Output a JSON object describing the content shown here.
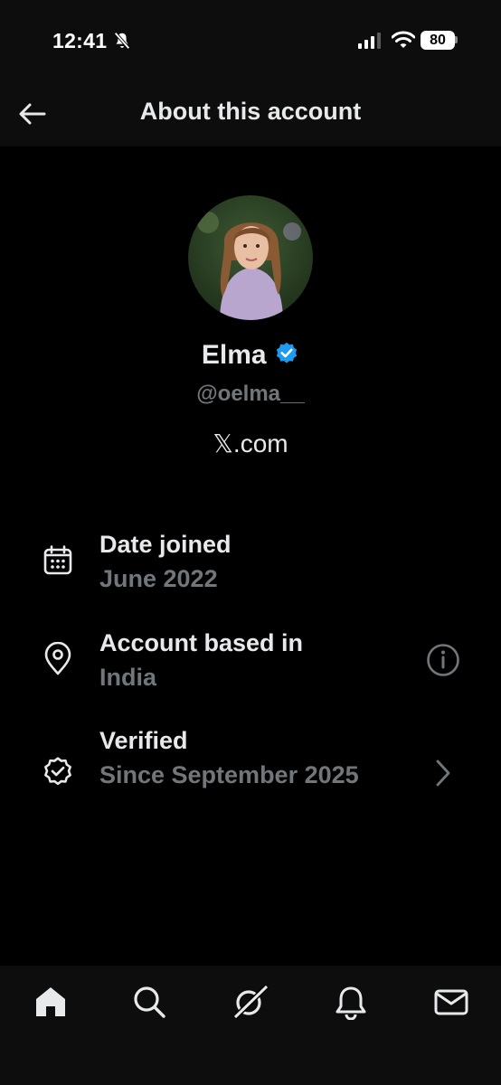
{
  "status_bar": {
    "time": "12:41",
    "battery": "80"
  },
  "header": {
    "title": "About this account"
  },
  "profile": {
    "name": "Elma",
    "handle": "@oelma__",
    "site": "𝕏.com"
  },
  "rows": [
    {
      "title": "Date joined",
      "value": "June 2022",
      "icon": "calendar-icon"
    },
    {
      "title": "Account based in",
      "value": "India",
      "icon": "location-pin-icon",
      "action_icon": "info-icon"
    },
    {
      "title": "Verified",
      "value": "Since September 2025",
      "icon": "verified-seal-icon",
      "action_icon": "chevron-right-icon"
    }
  ],
  "tabbar": {
    "tabs": [
      "home-icon",
      "search-icon",
      "grok-icon",
      "notifications-icon",
      "messages-icon"
    ]
  },
  "colors": {
    "background": "#000000",
    "bar": "#0d0d0d",
    "primary_text": "#e7e9ea",
    "secondary_text": "#71767b",
    "verified_blue": "#1d9bf0"
  }
}
